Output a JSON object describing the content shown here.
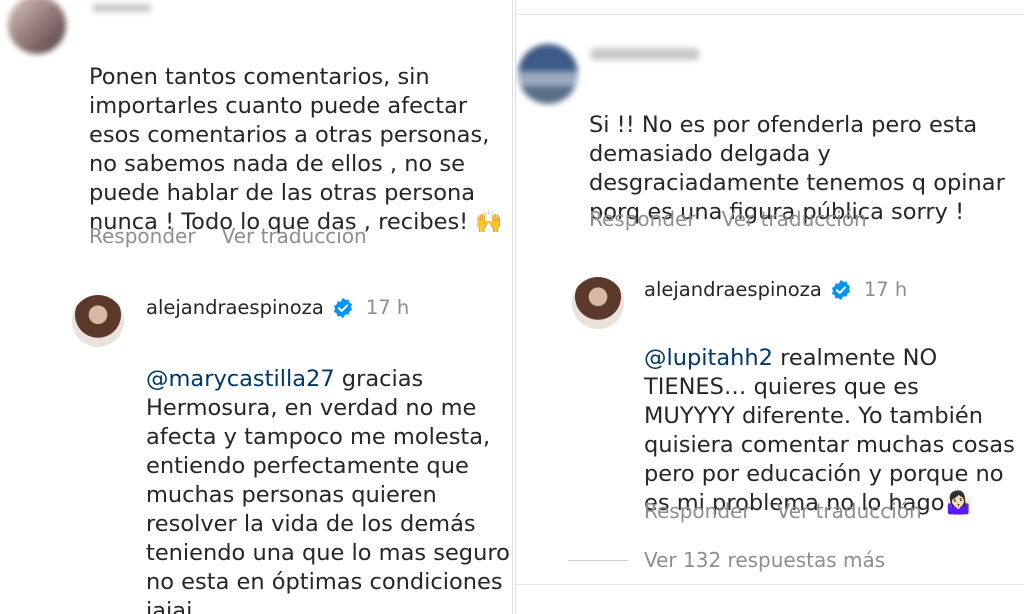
{
  "left": {
    "comment": {
      "text": "Ponen tantos comentarios, sin\nimportarles cuanto puede afectar\nesos comentarios a otras personas,\nno sabemos nada de ellos , no se\npuede hablar de las otras persona\nnunca ! Todo lo que das , recibes!",
      "emoji": "🙌",
      "reply_label": "Responder",
      "translate_label": "Ver traducción"
    },
    "reply": {
      "username": "alejandraespinoza",
      "time": "17 h",
      "mention": "@marycastilla27",
      "text": " gracias\nHermosura, en verdad no me\nafecta y tampoco me molesta,\nentiendo perfectamente que\nmuchas personas quieren\nresolver la vida de los demás\nteniendo una que lo mas seguro\nno esta en óptimas condiciones\njajaj"
    }
  },
  "right": {
    "comment": {
      "text": "Si !! No es por ofenderla pero esta\ndemasiado delgada y\ndesgraciadamente tenemos q opinar\nporq es una figura pública sorry !",
      "reply_label": "Responder",
      "translate_label": "Ver traducción"
    },
    "reply": {
      "username": "alejandraespinoza",
      "time": "17 h",
      "mention": "@lupitahh2",
      "text": "  realmente NO\nTIENES… quieres que es\nMUYYYY diferente. Yo también\nquisiera comentar muchas cosas\npero por educación y porque no\nes mi problema no lo hago",
      "emoji": "🤷🏻‍♀️",
      "reply_label": "Responder",
      "translate_label": "Ver traducción"
    },
    "more_replies": "Ver 132 respuestas más"
  },
  "colors": {
    "text": "#262626",
    "secondary": "#8e8e8e",
    "mention": "#00376b",
    "verified": "#0095f6"
  }
}
